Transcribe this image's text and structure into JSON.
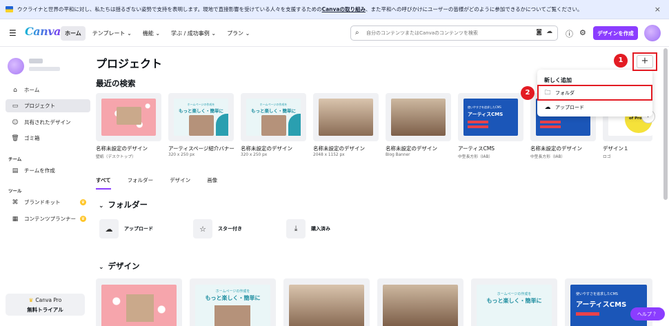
{
  "banner": {
    "text_before": "ウクライナと世界の平和に対し、私たちは揺るぎない姿勢で支持を表明します。現地で直接影響を受けている人々を支援するための",
    "link": "Canvaの取り組み",
    "text_after": "、また平和への呼びかけにユーザーの皆様がどのように参加できるかについてご覧ください。",
    "close": "×"
  },
  "nav": {
    "logo": "Canva",
    "items": [
      "ホーム",
      "テンプレート ⌄",
      "機能 ⌄",
      "学ぶ / 成功事例 ⌄",
      "プラン ⌄"
    ],
    "search_placeholder": "自分のコンテンツまたはCanvaのコンテンツを検索",
    "create_label": "デザインを作成"
  },
  "sidebar": {
    "items": [
      {
        "label": "ホーム",
        "icon": "home-icon"
      },
      {
        "label": "プロジェクト",
        "icon": "folder-icon"
      },
      {
        "label": "共有されたデザイン",
        "icon": "users-icon"
      },
      {
        "label": "ゴミ箱",
        "icon": "trash-icon"
      }
    ],
    "team_heading": "チーム",
    "team_item": "チームを作成",
    "tools_heading": "ツール",
    "tools": [
      "ブランドキット",
      "コンテンツプランナー"
    ],
    "pro_line1": "Canva Pro",
    "pro_line2": "無料トライアル"
  },
  "main": {
    "title": "プロジェクト",
    "recent_title": "最近の検索",
    "recent": [
      {
        "name": "名称未設定のデザイン",
        "sub": "壁紙（デスクトップ）"
      },
      {
        "name": "アーティスページ紹介バナー",
        "sub": "320 x 250 px"
      },
      {
        "name": "名称未設定のデザイン",
        "sub": "320 x 250 px"
      },
      {
        "name": "名称未設定のデザイン",
        "sub": "2048 x 1152 px"
      },
      {
        "name": "名称未設定のデザイン",
        "sub": "Blog Banner"
      },
      {
        "name": "アーティスCMS",
        "sub": "中型長方形（IAB）"
      },
      {
        "name": "名称未設定のデザイン",
        "sub": "中型長方形（IAB）"
      },
      {
        "name": "デザイン１",
        "sub": "ロゴ"
      }
    ],
    "thumb_texts": {
      "lp_small": "ホームページの作成を",
      "lp_big": "もっと楽しく・簡単に",
      "cms_small": "使いやすさを追求したCMS",
      "cms_big": "アーティスCMS",
      "logo_partial": "of Pros"
    },
    "tabs": [
      "すべて",
      "フォルダー",
      "デザイン",
      "画像"
    ],
    "folders_title": "フォルダー",
    "folders": [
      "アップロード",
      "スター付き",
      "購入済み"
    ],
    "designs_title": "デザイン"
  },
  "dropdown": {
    "title": "新しく追加",
    "items": [
      "フォルダ",
      "アップロード"
    ]
  },
  "annotations": {
    "step1": "1",
    "step2": "2"
  },
  "help_label": "ヘルプ ？"
}
